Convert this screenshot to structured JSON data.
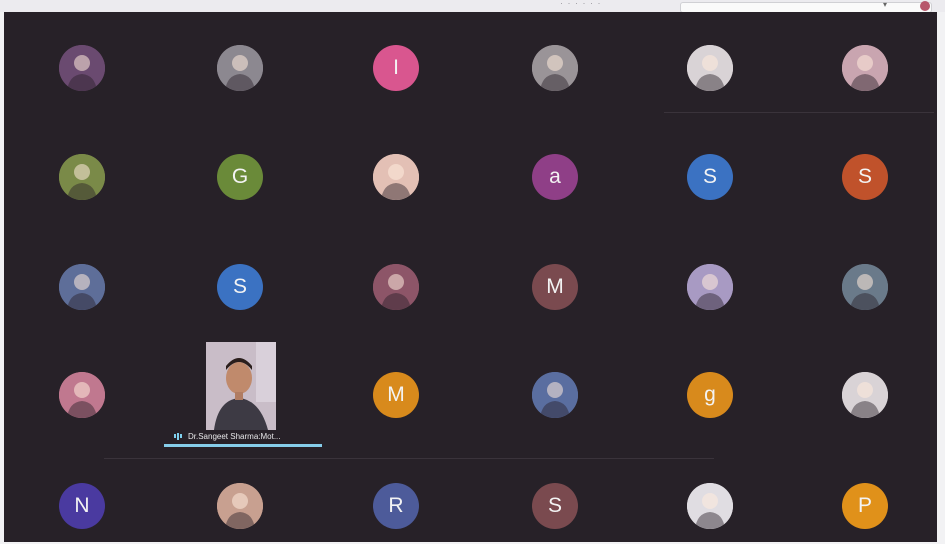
{
  "window": {
    "caption": "· · · · · ·",
    "accent_color": "#86cdea",
    "background_color": "#272128"
  },
  "participants": [
    {
      "type": "photo",
      "name": "logo-avatar",
      "bg": "#6a4a70"
    },
    {
      "type": "photo",
      "name": "person-avatar",
      "bg": "#8c8890"
    },
    {
      "type": "initial",
      "letter": "I",
      "bg": "#d9568f"
    },
    {
      "type": "photo",
      "name": "person-avatar",
      "bg": "#9a9498"
    },
    {
      "type": "photo",
      "name": "person-avatar",
      "bg": "#d9d3d6"
    },
    {
      "type": "photo",
      "name": "person-avatar",
      "bg": "#c9a5b0"
    },
    {
      "type": "photo",
      "name": "tree-avatar",
      "bg": "#7a8a48"
    },
    {
      "type": "initial",
      "letter": "G",
      "bg": "#6a8a39"
    },
    {
      "type": "photo",
      "name": "person-avatar",
      "bg": "#e3c0b5"
    },
    {
      "type": "initial",
      "letter": "a",
      "bg": "#8f3f87"
    },
    {
      "type": "initial",
      "letter": "S",
      "bg": "#3b72c2"
    },
    {
      "type": "initial",
      "letter": "S",
      "bg": "#c0522b"
    },
    {
      "type": "photo",
      "name": "person-avatar",
      "bg": "#5e6e99"
    },
    {
      "type": "initial",
      "letter": "S",
      "bg": "#3b72c2"
    },
    {
      "type": "photo",
      "name": "person-avatar",
      "bg": "#8d5568"
    },
    {
      "type": "initial",
      "letter": "M",
      "bg": "#7a4a4f"
    },
    {
      "type": "photo",
      "name": "flower-avatar",
      "bg": "#a89ac3"
    },
    {
      "type": "photo",
      "name": "object-avatar",
      "bg": "#6a7a8a"
    },
    {
      "type": "photo",
      "name": "group-avatar",
      "bg": "#c0788f"
    },
    {
      "type": "video",
      "name": "active-speaker-video",
      "bg": "#000000"
    },
    {
      "type": "initial",
      "letter": "M",
      "bg": "#d88a1c"
    },
    {
      "type": "photo",
      "name": "person-avatar",
      "bg": "#5a6ea0"
    },
    {
      "type": "initial",
      "letter": "g",
      "bg": "#d88a1c"
    },
    {
      "type": "photo",
      "name": "sphere-avatar",
      "bg": "#d9d3d6"
    },
    {
      "type": "initial",
      "letter": "N",
      "bg": "#4a3aa0"
    },
    {
      "type": "photo",
      "name": "person-avatar",
      "bg": "#c8a090"
    },
    {
      "type": "initial",
      "letter": "R",
      "bg": "#4d5b9a"
    },
    {
      "type": "initial",
      "letter": "S",
      "bg": "#7a4a4f"
    },
    {
      "type": "photo",
      "name": "flower-avatar",
      "bg": "#e0dde2"
    },
    {
      "type": "initial",
      "letter": "P",
      "bg": "#e0911a"
    }
  ],
  "speaker": {
    "name": "Dr.Sangeet Sharma:Mot..."
  }
}
